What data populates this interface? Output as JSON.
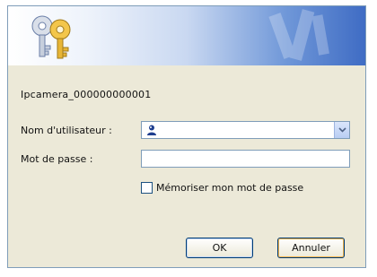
{
  "dialog": {
    "host_label": "Ipcamera_000000000001",
    "user_label": "Nom d'utilisateur :",
    "user_value": "",
    "password_label": "Mot de passe :",
    "password_value": "",
    "remember_label": "Mémoriser mon mot de passe",
    "remember_checked": false,
    "ok_label": "OK",
    "cancel_label": "Annuler"
  },
  "icons": {
    "banner": "keys-icon",
    "user": "user-icon",
    "dropdown": "chevron-down-icon"
  },
  "colors": {
    "banner_dark": "#3f6cc4",
    "dialog_bg": "#ece9d8",
    "border": "#7f9db9"
  }
}
